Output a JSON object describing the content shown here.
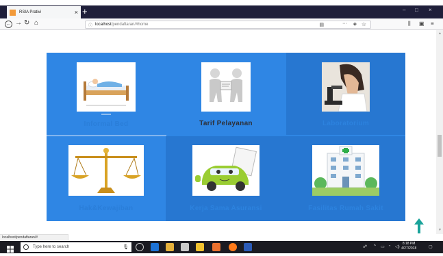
{
  "browser": {
    "tab_title": "RSIA Prativi",
    "tab_close": "×",
    "new_tab": "+",
    "url_host": "localhost",
    "url_path": "/pendaftaran/#home",
    "url_menu": "···",
    "win_min": "–",
    "win_max": "□",
    "win_close": "×"
  },
  "status_url": "localhost/pendaftaran/#",
  "tiles": [
    {
      "label": "Informal Bed",
      "icon": "bed-icon"
    },
    {
      "label": "Tarif Pelayanan",
      "icon": "handshake-icon"
    },
    {
      "label": "Laboratorium",
      "icon": "microscope-icon"
    },
    {
      "label": "Hak&Kewajiban",
      "icon": "scales-icon"
    },
    {
      "label": "Kerja Sama Asuransi",
      "icon": "car-insurance-icon"
    },
    {
      "label": "Fasilitas Rumah Sakit",
      "icon": "hospital-icon"
    }
  ],
  "taskbar": {
    "search_placeholder": "Type here to search",
    "time": "8:18 PM",
    "date": "4/27/2018"
  },
  "colors": {
    "tile_blue": "#2f86e4",
    "tile_blue_dark": "#2777d1",
    "chrome_dark": "#1f1f3a",
    "taskbar": "#1b1b22"
  }
}
